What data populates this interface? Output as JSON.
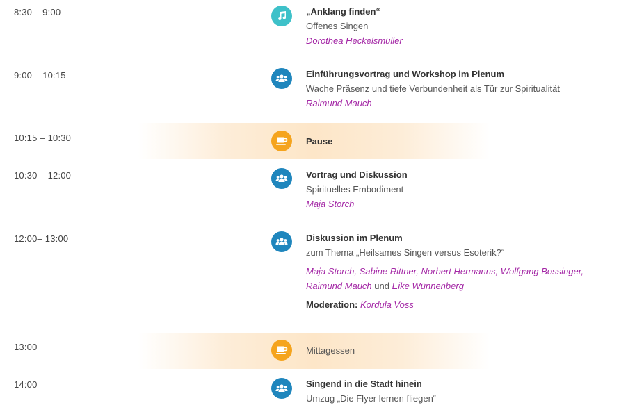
{
  "schedule": [
    {
      "time": "8:30 – 9:00",
      "icon": "music-note-icon",
      "title": "„Anklang finden“",
      "subtitle": "Offenes Singen",
      "person": "Dorothea Heckelsmüller"
    },
    {
      "time": "9:00 – 10:15",
      "icon": "group-icon",
      "title": "Einführungsvortrag und Workshop im Plenum",
      "subtitle": "Wache Präsenz und tiefe Verbundenheit als Tür zur Spiritualität",
      "person": "Raimund Mauch"
    },
    {
      "time": "10:15 – 10:30",
      "icon": "coffee-cup-icon",
      "title": "Pause"
    },
    {
      "time": "10:30 – 12:00",
      "icon": "group-icon",
      "title": "Vortrag und Diskussion",
      "subtitle": "Spirituelles Embodiment",
      "person": "Maja Storch"
    },
    {
      "time": "12:00– 13:00",
      "icon": "group-icon",
      "title": "Diskussion im Plenum",
      "subtitle": "zum Thema „Heilsames Singen versus Esoterik?“",
      "participants": {
        "p1": "Maja Storch",
        "sep1": ", ",
        "p2": "Sabine Rittner",
        "sep2": ", ",
        "p3": "Norbert Hermanns",
        "sep3": ", ",
        "p4": "Wolfgang Bossinger",
        "sep4": ",",
        "p5": "Raimund Mauch",
        "sep5": " und ",
        "p6": "Eike Wünnenberg"
      },
      "moderation_label": "Moderation:",
      "moderator": "Kordula Voss"
    },
    {
      "time": "13:00",
      "icon": "coffee-cup-icon",
      "title": "Mittagessen"
    },
    {
      "time": "14:00",
      "icon": "group-icon",
      "title": "Singend in die Stadt hinein",
      "subtitle": "Umzug „Die Flyer lernen fliegen“"
    }
  ],
  "colors": {
    "teal": "#3ec1c9",
    "blue": "#1f86bd",
    "orange": "#f5a41e",
    "person": "#a428a6",
    "band": "#fde6c8"
  }
}
